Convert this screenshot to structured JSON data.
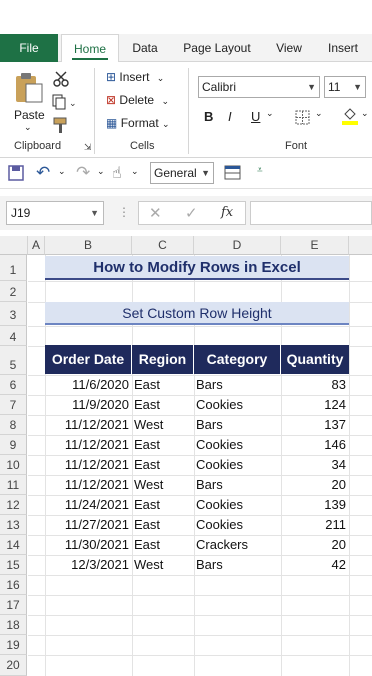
{
  "ribbon_tabs": [
    "File",
    "Home",
    "Data",
    "Page Layout",
    "View",
    "Insert"
  ],
  "ribbon": {
    "paste_label": "Paste",
    "clipboard_label": "Clipboard",
    "insert_label": "Insert",
    "delete_label": "Delete",
    "format_label": "Format",
    "cells_label": "Cells",
    "font_name": "Calibri",
    "font_size": "11",
    "bold": "B",
    "italic": "I",
    "underline": "U",
    "font_label": "Font"
  },
  "qat": {
    "number_format": "General"
  },
  "formula_bar": {
    "name_box": "J19",
    "fx": "fx",
    "formula": ""
  },
  "columns": [
    "A",
    "B",
    "C",
    "D",
    "E"
  ],
  "rows": [
    "1",
    "2",
    "3",
    "4",
    "5",
    "6",
    "7",
    "8",
    "9",
    "10",
    "11",
    "12",
    "13",
    "14",
    "15",
    "16",
    "17",
    "18",
    "19",
    "20"
  ],
  "sheet": {
    "title": "How to Modify Rows in Excel",
    "subtitle": "Set Custom Row Height",
    "headers": [
      "Order Date",
      "Region",
      "Category",
      "Quantity"
    ],
    "data": [
      [
        "11/6/2020",
        "East",
        "Bars",
        "83"
      ],
      [
        "11/9/2020",
        "East",
        "Cookies",
        "124"
      ],
      [
        "11/12/2021",
        "West",
        "Bars",
        "137"
      ],
      [
        "11/12/2021",
        "East",
        "Cookies",
        "146"
      ],
      [
        "11/12/2021",
        "East",
        "Cookies",
        "34"
      ],
      [
        "11/12/2021",
        "West",
        "Bars",
        "20"
      ],
      [
        "11/24/2021",
        "East",
        "Cookies",
        "139"
      ],
      [
        "11/27/2021",
        "East",
        "Cookies",
        "211"
      ],
      [
        "11/30/2021",
        "East",
        "Crackers",
        "20"
      ],
      [
        "12/3/2021",
        "West",
        "Bars",
        "42"
      ]
    ]
  },
  "colors": {
    "excel_green": "#1e7145",
    "header_navy": "#1f2a5c",
    "title_fill": "#dbe3f2"
  }
}
